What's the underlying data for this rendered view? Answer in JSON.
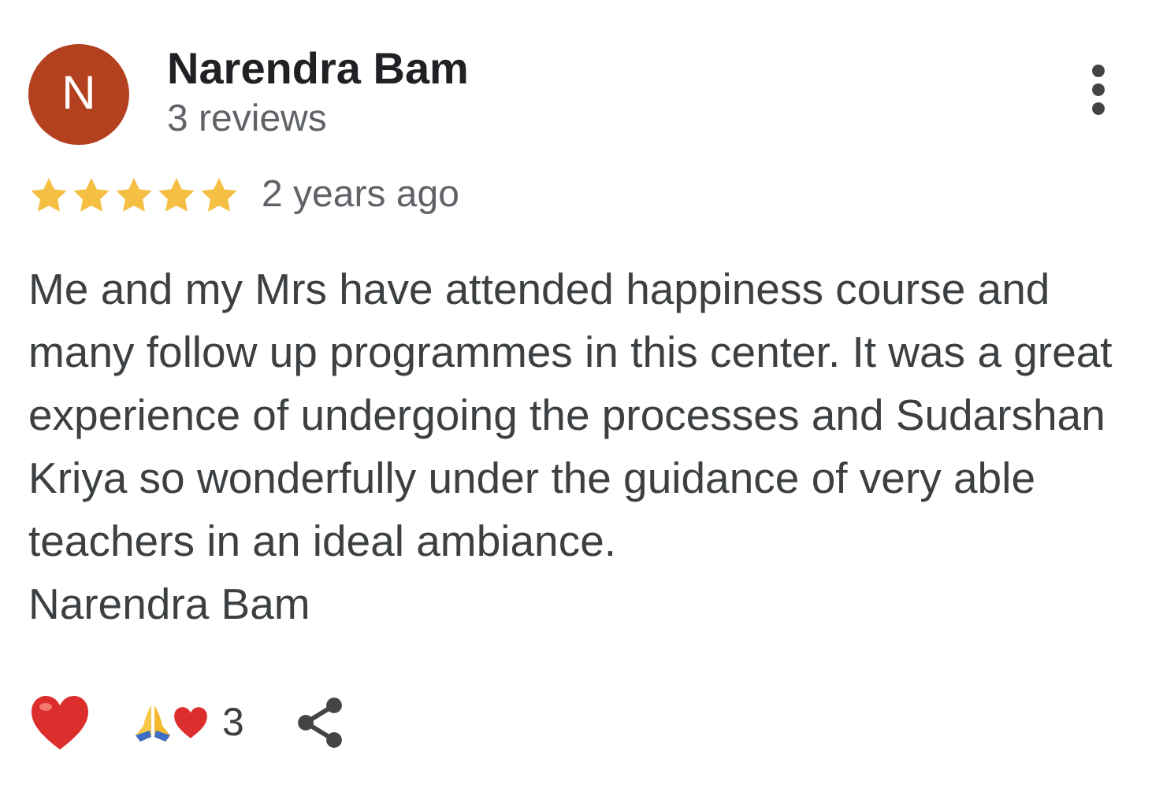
{
  "reviewer": {
    "initial": "N",
    "name": "Narendra Bam",
    "reviews": "3 reviews"
  },
  "rating": {
    "stars": 5,
    "time": "2 years ago"
  },
  "review_text": "Me and my Mrs have attended happiness course and many follow up programmes in this center. It was a great experience of undergoing the processes and Sudarshan Kriya so wonderfully under the guidance of very able teachers in an ideal ambiance.\nNarendra Bam",
  "reactions": {
    "count": "3"
  }
}
